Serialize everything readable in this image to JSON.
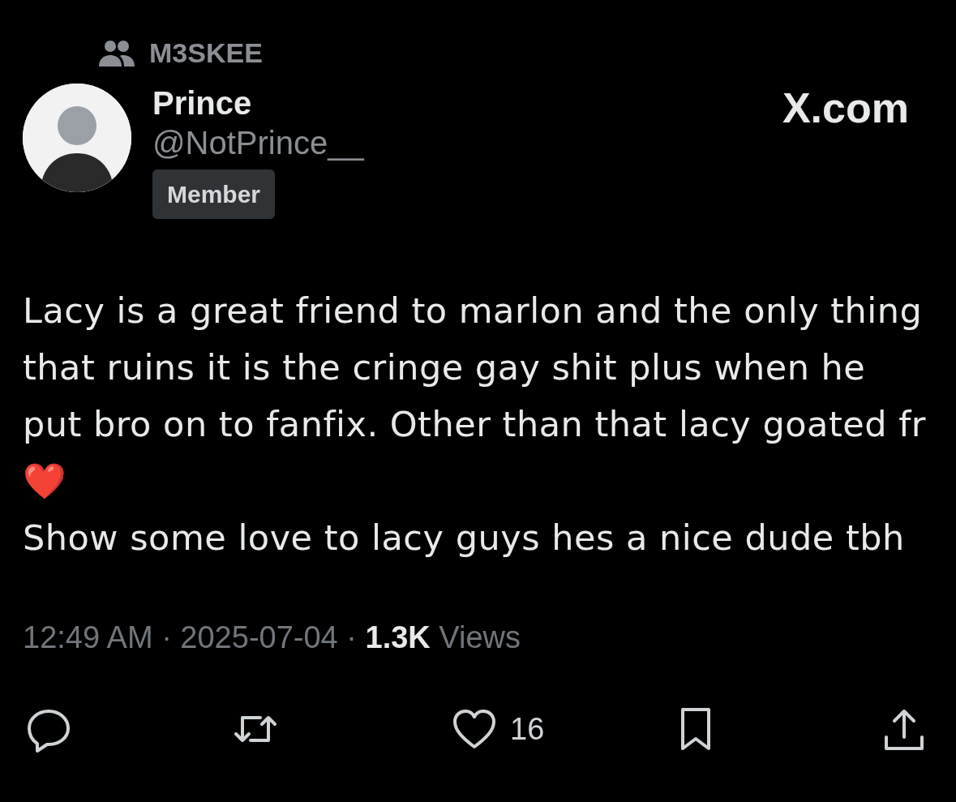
{
  "community": {
    "name": "M3SKEE"
  },
  "author": {
    "name": "Prince",
    "handle": "@NotPrince__",
    "role": "Member"
  },
  "source": "X.com",
  "body": "Lacy is a great friend to marlon and the only thing that ruins it is the cringe gay shit plus when he put bro on to fanfix. Other than that lacy goated fr❤️\nShow some love to lacy guys hes a nice dude tbh",
  "meta": {
    "time": "12:49 AM",
    "separator_1": "·",
    "date": "2025-07-04",
    "separator_2": "·",
    "views": "1.3K",
    "views_label": "Views"
  },
  "actions": [
    {
      "kind": "reply"
    },
    {
      "kind": "repost"
    },
    {
      "kind": "like",
      "count": "16"
    },
    {
      "kind": "bookmark"
    },
    {
      "kind": "share"
    }
  ]
}
